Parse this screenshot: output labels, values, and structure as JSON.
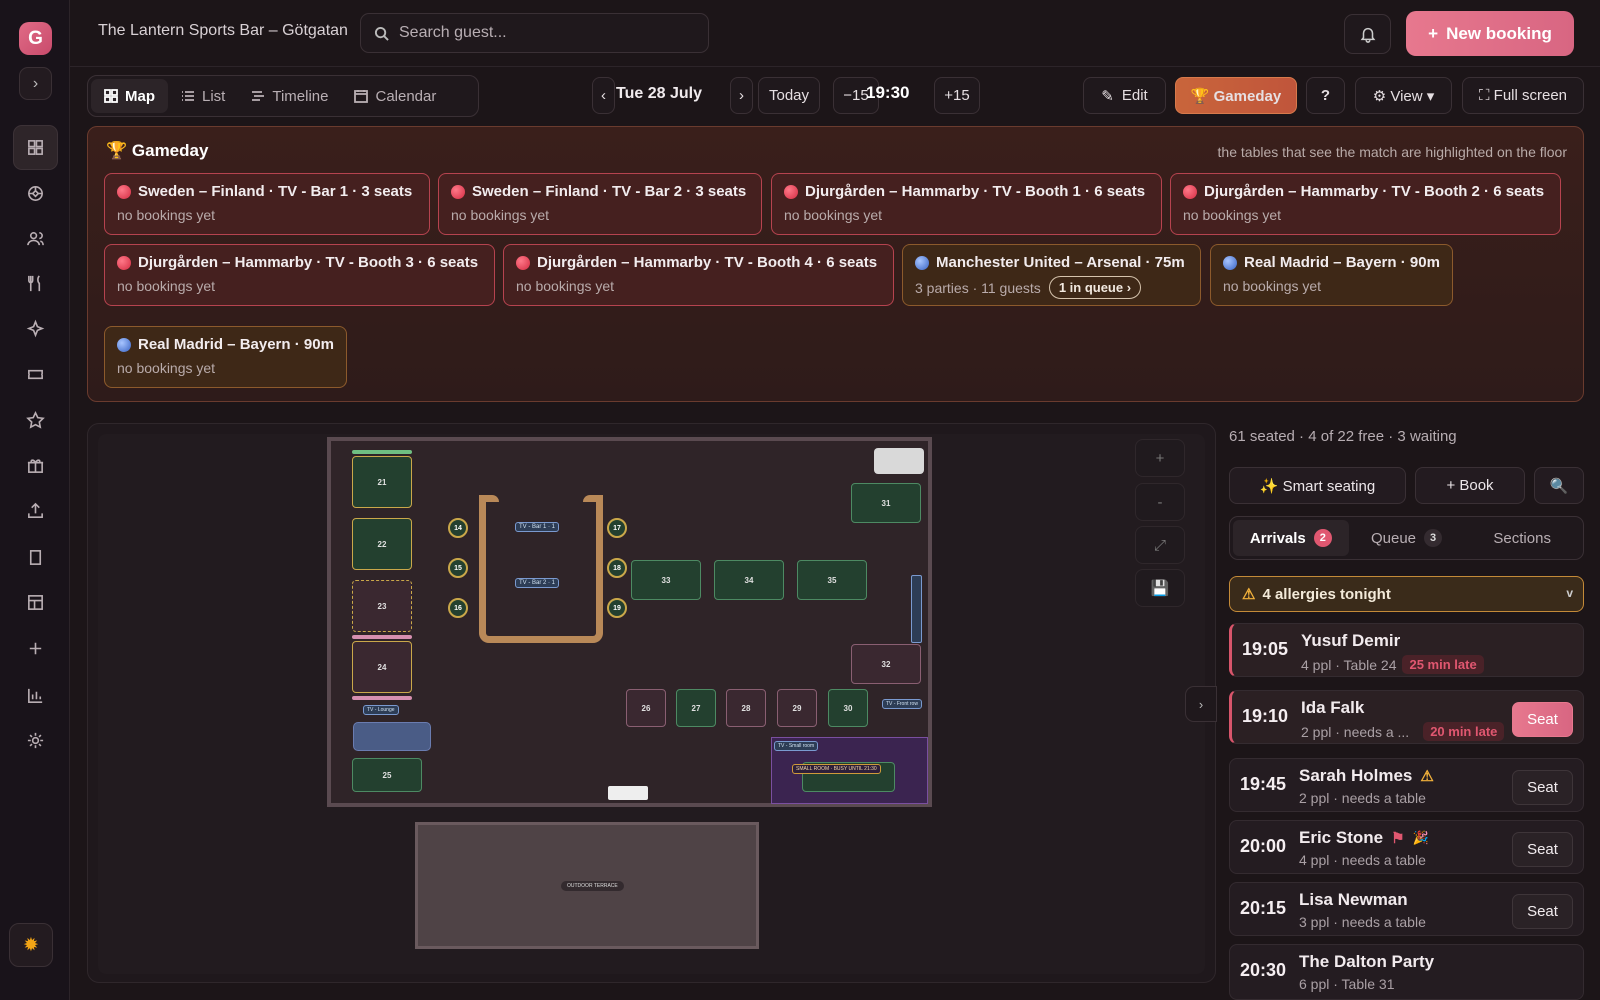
{
  "sidebar": {
    "logo": "G",
    "expand": "›"
  },
  "header": {
    "venue": "The Lantern Sports Bar – Götgatan",
    "search_placeholder": "Search guest...",
    "new_booking": "New booking"
  },
  "toolbar": {
    "tabs": [
      {
        "label": "Map"
      },
      {
        "label": "List"
      },
      {
        "label": "Timeline"
      },
      {
        "label": "Calendar"
      }
    ],
    "prev": "‹",
    "date": "Tue 28 July",
    "next": "›",
    "today": "Today",
    "minus": "−15",
    "time": "19:30",
    "plus": "+15",
    "edit": "Edit",
    "gameday": "🏆 Gameday",
    "help": "?",
    "view": "⚙ View ▾",
    "fullscreen": "⛶ Full screen"
  },
  "gameday": {
    "title": "🏆 Gameday",
    "note": "the tables that see the match are highlighted on the floor",
    "cards": [
      {
        "title": "Sweden – Finland · TV - Bar 1 · 3 seats",
        "sub": "no bookings yet"
      },
      {
        "title": "Sweden – Finland · TV - Bar 2 · 3 seats",
        "sub": "no bookings yet"
      },
      {
        "title": "Djurgården – Hammarby · TV - Booth 1 · 6 seats",
        "sub": "no bookings yet"
      },
      {
        "title": "Djurgården – Hammarby · TV - Booth 2 · 6 seats",
        "sub": "no bookings yet"
      },
      {
        "title": "Djurgården – Hammarby · TV - Booth 3 · 6 seats",
        "sub": "no bookings yet"
      },
      {
        "title": "Djurgården – Hammarby · TV - Booth 4 · 6 seats",
        "sub": "no bookings yet"
      },
      {
        "title": "Manchester United – Arsenal · 75m",
        "sub": "3 parties · 11 guests",
        "queue": "1 in queue ›"
      },
      {
        "title": "Real Madrid – Bayern · 90m",
        "sub": "no bookings yet"
      },
      {
        "title": "Real Madrid – Bayern · 90m",
        "sub": "no bookings yet"
      }
    ]
  },
  "map": {
    "tables": [
      "21",
      "22",
      "23",
      "24",
      "25",
      "14",
      "15",
      "16",
      "17",
      "18",
      "19",
      "33",
      "34",
      "35",
      "31",
      "32",
      "26",
      "27",
      "28",
      "29",
      "30"
    ],
    "tv_bar1": "TV - Bar 1 · 1",
    "tv_bar2": "TV - Bar 2 · 1",
    "tv_lounge": "TV - Lounge",
    "tv_front": "TV - Front row",
    "tv_small": "TV - Small room",
    "small_room": "SMALL ROOM · BUSY UNTIL 21:30",
    "terrace": "OUTDOOR TERRACE",
    "zoom_in": "+",
    "zoom_out": "-",
    "fit": "⤢",
    "save": "💾",
    "collapse": "›"
  },
  "right": {
    "stats": "61 seated · 4 of 22 free · 3 waiting",
    "smart": "✨ Smart seating",
    "book": "+ Book",
    "search": "🔍",
    "tabs": [
      {
        "label": "Arrivals",
        "count": "2"
      },
      {
        "label": "Queue",
        "count": "3"
      },
      {
        "label": "Sections"
      }
    ],
    "allergy": "4 allergies tonight",
    "arrivals": [
      {
        "time": "19:05",
        "name": "Yusuf Demir",
        "detail": "4 ppl · Table 24",
        "late": "25 min late"
      },
      {
        "time": "19:10",
        "name": "Ida Falk",
        "detail": "2 ppl · needs a ...",
        "late": "20 min late",
        "action": "Seat"
      },
      {
        "time": "19:45",
        "name": "Sarah Holmes",
        "detail": "2 ppl · needs a table",
        "action": "Seat"
      },
      {
        "time": "20:00",
        "name": "Eric Stone",
        "detail": "4 ppl · needs a table",
        "action": "Seat"
      },
      {
        "time": "20:15",
        "name": "Lisa Newman",
        "detail": "3 ppl · needs a table",
        "action": "Seat"
      },
      {
        "time": "20:30",
        "name": "The Dalton Party",
        "detail": "6 ppl · Table 31"
      }
    ]
  },
  "colors": {
    "accent": "#e06b86",
    "gameday_bg": "#3a1f1b",
    "late_red": "#e05770",
    "table_green": "#4d8a63"
  }
}
